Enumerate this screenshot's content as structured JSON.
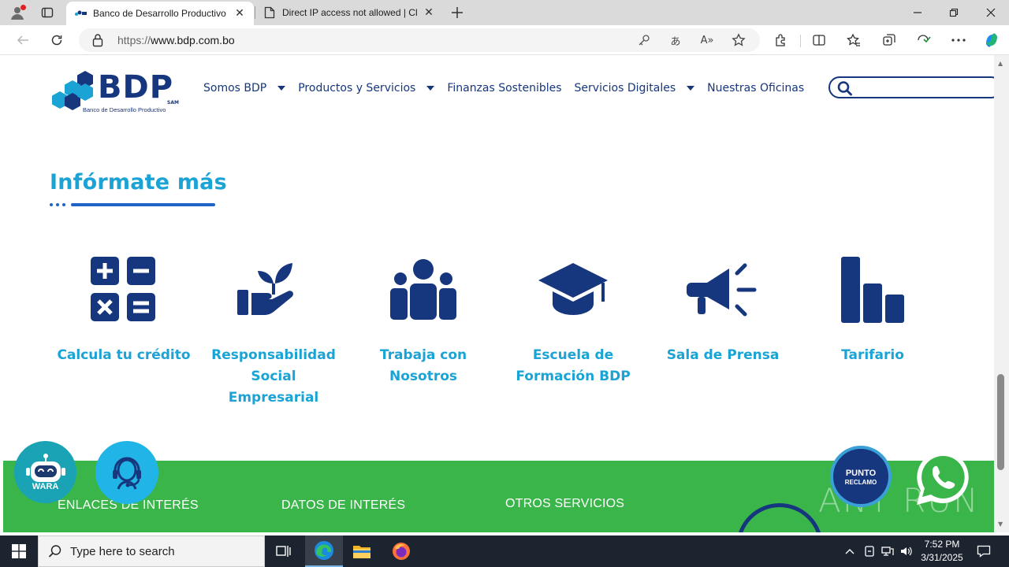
{
  "browser": {
    "tabs": [
      {
        "title": "Banco de Desarrollo Productivo -",
        "active": true
      },
      {
        "title": "Direct IP access not allowed | Clo",
        "active": false
      }
    ],
    "url_prefix": "https://",
    "url_host": "www.bdp.com.bo"
  },
  "site": {
    "logo": {
      "brand": "BDP",
      "suffix": "SAM",
      "tagline": "Banco de Desarrollo Productivo"
    },
    "menu": [
      {
        "label": "Somos BDP",
        "dropdown": true
      },
      {
        "label": "Productos y Servicios",
        "dropdown": true
      },
      {
        "label": "Finanzas Sostenibles",
        "dropdown": false
      },
      {
        "label": "Servicios Digitales",
        "dropdown": true
      },
      {
        "label": "Nuestras Oficinas",
        "dropdown": false
      }
    ],
    "search_placeholder": ""
  },
  "section": {
    "title": "Infórmate más",
    "cards": [
      {
        "label": "Calcula tu crédito",
        "icon": "calculator-icon"
      },
      {
        "label": "Responsabilidad Social Empresarial",
        "icon": "hand-plant-icon"
      },
      {
        "label": "Trabaja con Nosotros",
        "icon": "team-icon"
      },
      {
        "label": "Escuela de Formación BDP",
        "icon": "graduation-cap-icon"
      },
      {
        "label": "Sala de Prensa",
        "icon": "megaphone-icon"
      },
      {
        "label": "Tarifario",
        "icon": "bar-chart-icon"
      }
    ]
  },
  "footer": {
    "headings": [
      "ENLACES DE INTERÉS",
      "DATOS DE INTERÉS",
      "OTROS SERVICIOS"
    ],
    "wara_label": "WARA",
    "reclamo_line1": "PUNTO",
    "reclamo_line2": "RECLAMO",
    "watermark": "ANY RUN"
  },
  "taskbar": {
    "search_placeholder": "Type here to search",
    "time": "7:52 PM",
    "date": "3/31/2025"
  },
  "colors": {
    "brand_navy": "#16367e",
    "accent_cyan": "#1aa3d4",
    "footer_green": "#3ab54a"
  }
}
